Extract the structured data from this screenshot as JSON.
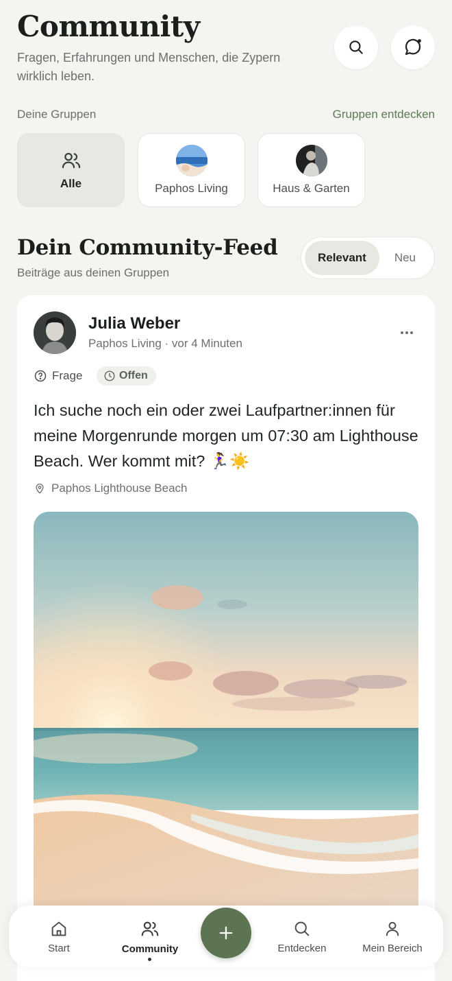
{
  "colors": {
    "background": "#f4f4f1",
    "accent_green": "#5d7453",
    "link_green": "#5e7a55",
    "chip_active": "#e5e9e1"
  },
  "header": {
    "title": "Community",
    "subtitle": "Fragen, Erfahrungen und Menschen, die Zypern wirklich leben.",
    "search_icon": "search-icon",
    "chat_icon": "chat-bubble-icon"
  },
  "groups": {
    "label": "Deine Gruppen",
    "discover_link": "Gruppen entdecken",
    "items": [
      {
        "label": "Alle",
        "icon": "users-icon",
        "active": true
      },
      {
        "label": "Paphos Living",
        "icon": "group-avatar-sea"
      },
      {
        "label": "Haus & Garten",
        "icon": "group-avatar-person"
      }
    ]
  },
  "feed": {
    "title": "Dein Community-Feed",
    "subtitle": "Beiträge aus deinen Gruppen",
    "sort_options": [
      "Relevant",
      "Neu"
    ],
    "selected_sort": "Relevant"
  },
  "post": {
    "author": "Julia Weber",
    "meta": "Paphos Living · vor 4 Minuten",
    "type_tag": "Frage",
    "status_tag": "Offen",
    "text": "Ich suche noch ein oder zwei Laufpartner:innen für meine Morgenrunde morgen um 07:30 am Lighthouse Beach. Wer kommt mit? 🏃‍♀️☀️",
    "location": "Paphos Lighthouse Beach"
  },
  "bottom_nav": {
    "items": [
      {
        "label": "Start",
        "icon": "home-icon"
      },
      {
        "label": "Community",
        "icon": "users-icon",
        "active": true
      },
      {
        "label": "Entdecken",
        "icon": "search-icon"
      },
      {
        "label": "Mein Bereich",
        "icon": "user-icon"
      }
    ],
    "fab_icon": "plus-icon"
  }
}
